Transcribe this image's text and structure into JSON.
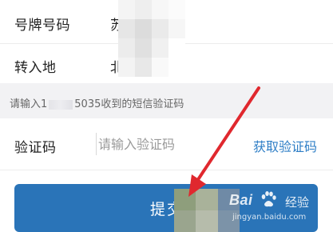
{
  "form": {
    "plate_label": "号牌号码",
    "plate_value": "苏",
    "transfer_label": "转入地",
    "transfer_value": "北京",
    "hint_prefix": "请输入1",
    "hint_suffix": "5035收到的短信验证码",
    "code_label": "验证码",
    "code_placeholder": "请输入验证码",
    "code_value": "",
    "get_code_label": "获取验证码",
    "submit_label": "提交"
  },
  "watermark": {
    "brand": "Bai",
    "brand_suffix": "经验",
    "url": "jingyan.baidu.com"
  },
  "colors": {
    "accent": "#2a74b8",
    "link": "#2e7ec6",
    "arrow": "#e0282e",
    "hint_band": "#f2f2f4"
  },
  "icons": {
    "arrow": "red-annotation-arrow",
    "paw": "baidu-paw-icon"
  }
}
